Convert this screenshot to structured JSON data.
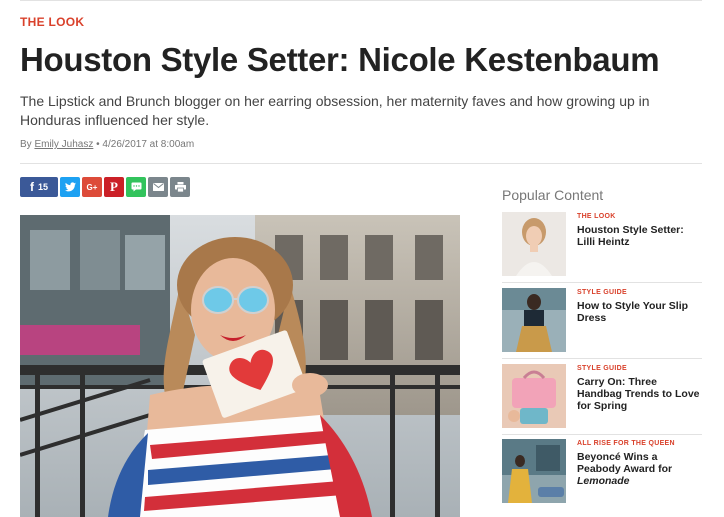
{
  "article": {
    "section": "THE LOOK",
    "title": "Houston Style Setter: Nicole Kestenbaum",
    "dek": "The Lipstick and Brunch blogger on her earring obsession, her maternity faves and how growing up in Honduras influenced her style.",
    "by_prefix": "By",
    "author": "Emily Juhasz",
    "date": "• 4/26/2017 at 8:00am"
  },
  "share": {
    "facebook_count": "15",
    "buttons": [
      {
        "icon": "facebook-icon",
        "color": "#3b5998"
      },
      {
        "icon": "twitter-icon",
        "color": "#1da1f2"
      },
      {
        "icon": "google-plus-icon",
        "color": "#dd4b39"
      },
      {
        "icon": "pinterest-icon",
        "color": "#cb2027"
      },
      {
        "icon": "sms-icon",
        "color": "#32c35c"
      },
      {
        "icon": "email-icon",
        "color": "#7b868c"
      },
      {
        "icon": "print-icon",
        "color": "#7b868c"
      }
    ]
  },
  "sidebar": {
    "heading": "Popular Content",
    "items": [
      {
        "category": "THE LOOK",
        "title": "Houston Style Setter: Lilli Heintz"
      },
      {
        "category": "STYLE GUIDE",
        "title": "How to Style Your Slip Dress"
      },
      {
        "category": "STYLE GUIDE",
        "title": "Carry On: Three Handbag Trends to Love for Spring"
      },
      {
        "category": "ALL RISE FOR THE QUEEN",
        "title_prefix": "Beyoncé Wins a Peabody Award for ",
        "title_em": "Lemonade"
      }
    ]
  },
  "colors": {
    "accent": "#d9412b",
    "text": "#222222",
    "muted": "#777777"
  }
}
